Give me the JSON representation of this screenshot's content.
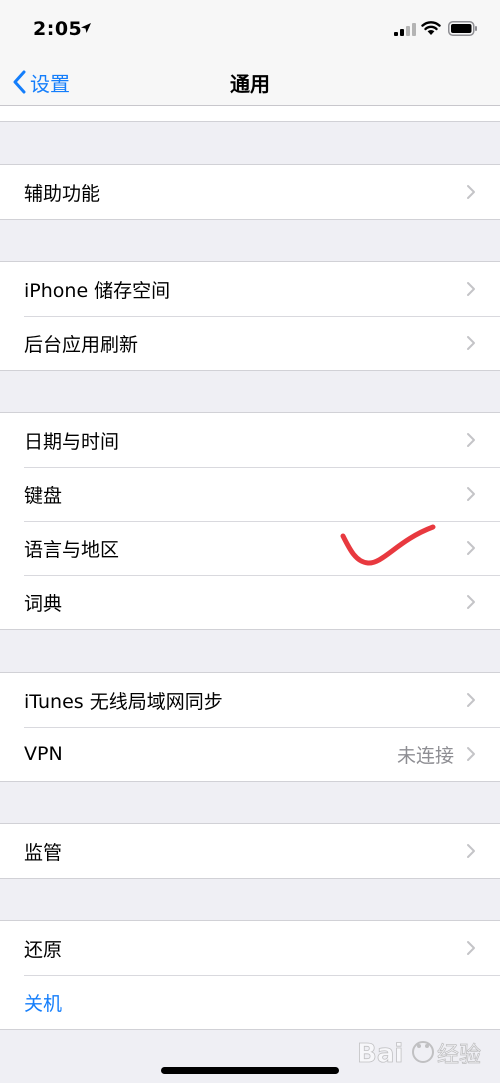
{
  "status": {
    "time": "2:05"
  },
  "nav": {
    "back_label": "设置",
    "title": "通用"
  },
  "groups": [
    {
      "items": [
        {
          "label": "辅助功能"
        }
      ]
    },
    {
      "items": [
        {
          "label": "iPhone 储存空间"
        },
        {
          "label": "后台应用刷新"
        }
      ]
    },
    {
      "items": [
        {
          "label": "日期与时间"
        },
        {
          "label": "键盘"
        },
        {
          "label": "语言与地区"
        },
        {
          "label": "词典"
        }
      ]
    },
    {
      "items": [
        {
          "label": "iTunes 无线局域网同步"
        },
        {
          "label": "VPN",
          "value": "未连接"
        }
      ]
    },
    {
      "items": [
        {
          "label": "监管"
        }
      ]
    },
    {
      "items": [
        {
          "label": "还原"
        },
        {
          "label": "关机"
        }
      ]
    }
  ],
  "colors": {
    "accent": "#147efb",
    "annotation": "#e8393f",
    "background": "#efeff4"
  },
  "watermark": {
    "text": "Bai经验"
  }
}
